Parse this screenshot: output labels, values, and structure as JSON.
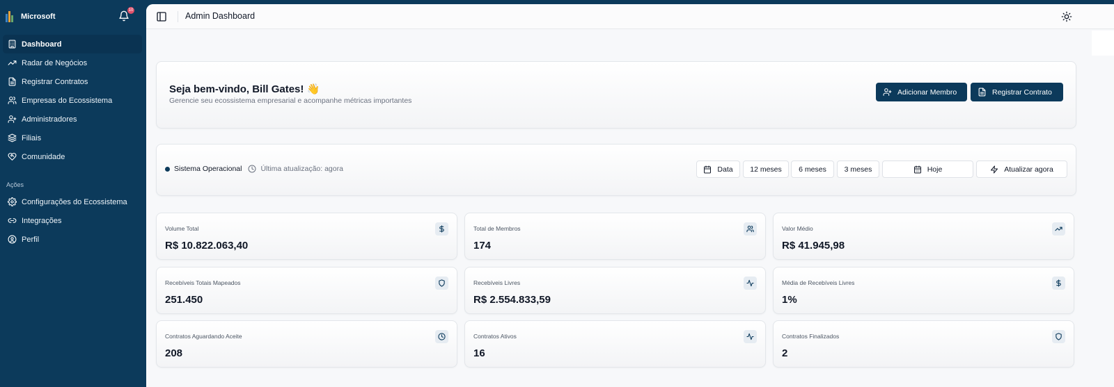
{
  "brand": {
    "name": "Microsoft",
    "notification_count": "10"
  },
  "sidebar": {
    "items": [
      {
        "label": "Dashboard",
        "icon": "building-icon",
        "active": true
      },
      {
        "label": "Radar de Negócios",
        "icon": "trending-up-icon"
      },
      {
        "label": "Registrar Contratos",
        "icon": "file-icon"
      },
      {
        "label": "Empresas do Ecossistema",
        "icon": "users-icon"
      },
      {
        "label": "Administradores",
        "icon": "user-icon"
      },
      {
        "label": "Filiais",
        "icon": "layers-icon"
      },
      {
        "label": "Comunidade",
        "icon": "heart-handshake-icon"
      }
    ],
    "section_label": "Ações",
    "actions": [
      {
        "label": "Configurações do Ecossistema",
        "icon": "gear-icon"
      },
      {
        "label": "Integrações",
        "icon": "link-icon"
      },
      {
        "label": "Perfil",
        "icon": "user-circle-icon"
      }
    ]
  },
  "header": {
    "title": "Admin Dashboard"
  },
  "welcome": {
    "title": "Seja bem-vindo, Bill Gates! 👋",
    "subtitle": "Gerencie seu ecossistema empresarial e acompanhe métricas importantes",
    "add_member_label": "Adicionar Membro",
    "register_contract_label": "Registrar Contrato"
  },
  "status": {
    "system_text": "Sistema Operacional",
    "updated_text": "Última atualização: agora",
    "filters": {
      "date": "Data",
      "m12": "12 meses",
      "m6": "6 meses",
      "m3": "3 meses",
      "today": "Hoje"
    },
    "refresh_label": "Atualizar agora"
  },
  "stats": [
    {
      "label": "Volume Total",
      "value": "R$ 10.822.063,40",
      "icon": "dollar-icon"
    },
    {
      "label": "Total de Membros",
      "value": "174",
      "icon": "users-icon"
    },
    {
      "label": "Valor Médio",
      "value": "R$ 41.945,98",
      "icon": "trending-up-icon"
    },
    {
      "label": "Recebíveis Totais Mapeados",
      "value": "251.450",
      "icon": "shield-icon"
    },
    {
      "label": "Recebíveis Livres",
      "value": "R$ 2.554.833,59",
      "icon": "activity-icon"
    },
    {
      "label": "Média de Recebíveis Livres",
      "value": "1%",
      "icon": "dollar-icon"
    },
    {
      "label": "Contratos Aguardando Aceite",
      "value": "208",
      "icon": "clock-icon"
    },
    {
      "label": "Contratos Ativos",
      "value": "16",
      "icon": "activity-icon"
    },
    {
      "label": "Contratos Finalizados",
      "value": "2",
      "icon": "shield-icon"
    }
  ],
  "colors": {
    "sidebar": "#0c3a5b",
    "accent": "#0c3a5b",
    "background": "#f7f8fa"
  }
}
